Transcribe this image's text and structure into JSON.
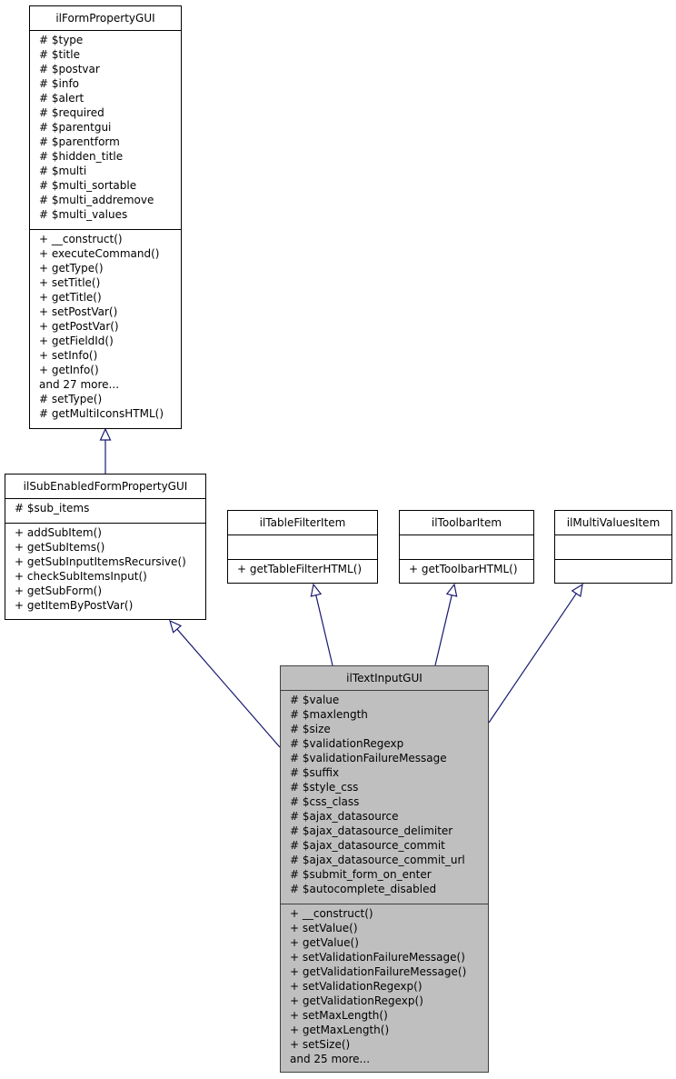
{
  "classes": {
    "ilFormPropertyGUI": {
      "name": "ilFormPropertyGUI",
      "attributes": [
        "# $type",
        "# $title",
        "# $postvar",
        "# $info",
        "# $alert",
        "# $required",
        "# $parentgui",
        "# $parentform",
        "# $hidden_title",
        "# $multi",
        "# $multi_sortable",
        "# $multi_addremove",
        "# $multi_values"
      ],
      "methods": [
        "+ __construct()",
        "+ executeCommand()",
        "+ getType()",
        "+ setTitle()",
        "+ getTitle()",
        "+ setPostVar()",
        "+ getPostVar()",
        "+ getFieldId()",
        "+ setInfo()",
        "+ getInfo()",
        "and 27 more...",
        "# setType()",
        "# getMultiIconsHTML()"
      ]
    },
    "ilSubEnabledFormPropertyGUI": {
      "name": "ilSubEnabledFormPropertyGUI",
      "attributes": [
        "# $sub_items"
      ],
      "methods": [
        "+ addSubItem()",
        "+ getSubItems()",
        "+ getSubInputItemsRecursive()",
        "+ checkSubItemsInput()",
        "+ getSubForm()",
        "+ getItemByPostVar()"
      ]
    },
    "ilTableFilterItem": {
      "name": "ilTableFilterItem",
      "attributes": [],
      "methods": [
        "+ getTableFilterHTML()"
      ]
    },
    "ilToolbarItem": {
      "name": "ilToolbarItem",
      "attributes": [],
      "methods": [
        "+ getToolbarHTML()"
      ]
    },
    "ilMultiValuesItem": {
      "name": "ilMultiValuesItem",
      "attributes": [],
      "methods": []
    },
    "ilTextInputGUI": {
      "name": "ilTextInputGUI",
      "attributes": [
        "# $value",
        "# $maxlength",
        "# $size",
        "# $validationRegexp",
        "# $validationFailureMessage",
        "# $suffix",
        "# $style_css",
        "# $css_class",
        "# $ajax_datasource",
        "# $ajax_datasource_delimiter",
        "# $ajax_datasource_commit",
        "# $ajax_datasource_commit_url",
        "# $submit_form_on_enter",
        "# $autocomplete_disabled"
      ],
      "methods": [
        "+ __construct()",
        "+ setValue()",
        "+ getValue()",
        "+ setValidationFailureMessage()",
        "+ getValidationFailureMessage()",
        "+ setValidationRegexp()",
        "+ getValidationRegexp()",
        "+ setMaxLength()",
        "+ getMaxLength()",
        "+ setSize()",
        "and 25 more..."
      ]
    }
  },
  "edges": [
    {
      "from": "ilSubEnabledFormPropertyGUI",
      "to": "ilFormPropertyGUI",
      "type": "inheritance"
    },
    {
      "from": "ilTextInputGUI",
      "to": "ilSubEnabledFormPropertyGUI",
      "type": "inheritance"
    },
    {
      "from": "ilTextInputGUI",
      "to": "ilTableFilterItem",
      "type": "inheritance"
    },
    {
      "from": "ilTextInputGUI",
      "to": "ilToolbarItem",
      "type": "inheritance"
    },
    {
      "from": "ilTextInputGUI",
      "to": "ilMultiValuesItem",
      "type": "inheritance"
    }
  ],
  "colors": {
    "edge": "#191970",
    "focus_fill": "#bfbfbf",
    "box_fill": "#ffffff"
  }
}
